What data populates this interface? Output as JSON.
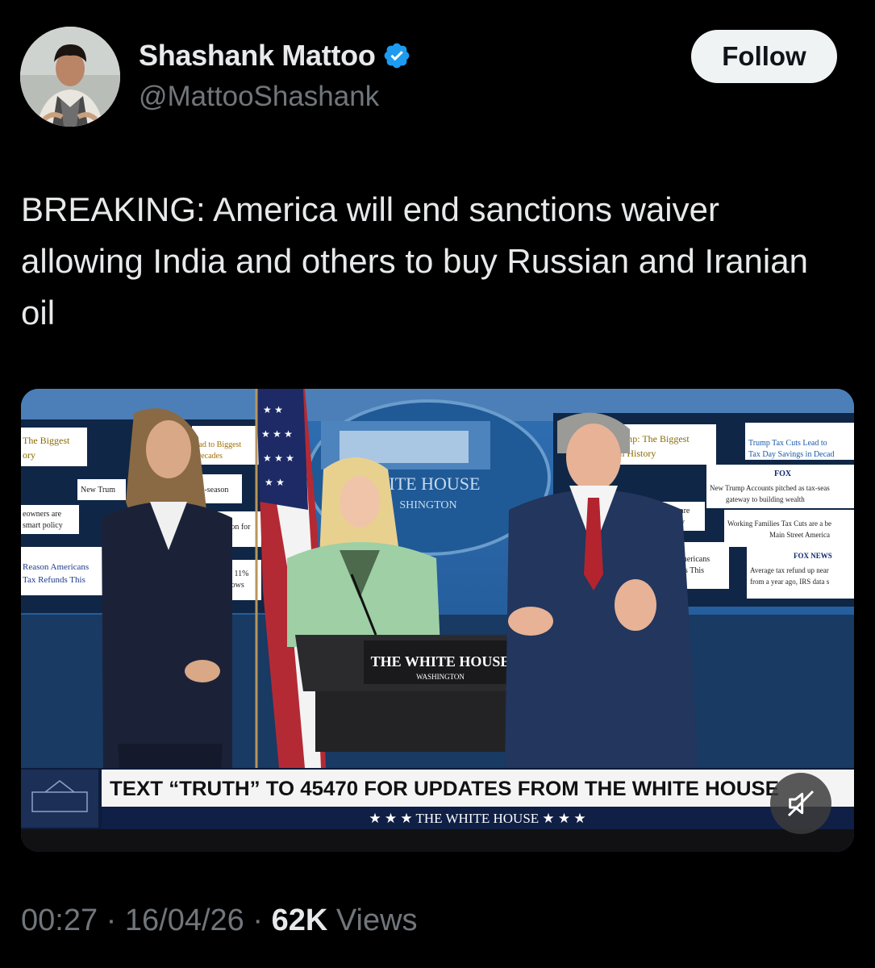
{
  "author": {
    "name": "Shashank Mattoo",
    "handle": "@MattooShashank",
    "verified": true,
    "avatar": "avatar-photo"
  },
  "follow_label": "Follow",
  "tweet": {
    "text": "BREAKING: America will end sanctions waiver allowing India and others to buy Russian and Iranian oil"
  },
  "video": {
    "chyron": "TEXT “TRUTH” TO 45470 FOR UPDATES FROM THE WHITE HOUSE",
    "chyron_sub": "★ ★ ★   THE WHITE HOUSE   ★ ★ ★",
    "podium_title": "THE WHITE HOUSE",
    "podium_sub": "WASHINGTON",
    "backdrop_title": "HITE HOUSE",
    "backdrop_sub": "SHINGTON",
    "left_screen": [
      "The Biggest",
      "ory",
      "New Trum",
      "eowners are",
      "smart policy",
      "Reason Americans",
      "Tax Refunds This",
      "ead to Biggest",
      "Decades",
      "ax-season",
      "beacon for",
      "early 11%",
      "ta shows"
    ],
    "right_screen": [
      "Trump: The Biggest",
      "r in History",
      "Trump Tax Cuts Lead to",
      "Tax Day Savings in Decad",
      "FOX",
      "New Trump Accounts pitched as tax-seas",
      "gateway to building wealth",
      "ners are",
      "policy",
      "Working Families Tax Cuts are a be",
      "Main Street America",
      "FOX NEWS",
      "mericans",
      "ds This",
      "Average tax refund up near",
      "from a year ago, IRS data s"
    ],
    "mute_icon": "muted-speaker-icon"
  },
  "meta": {
    "time": "00:27",
    "date": "16/04/26",
    "views_count": "62K",
    "views_label": "Views"
  },
  "colors": {
    "background": "#000000",
    "verified": "#1d9bf0",
    "secondary_text": "#71767b"
  }
}
